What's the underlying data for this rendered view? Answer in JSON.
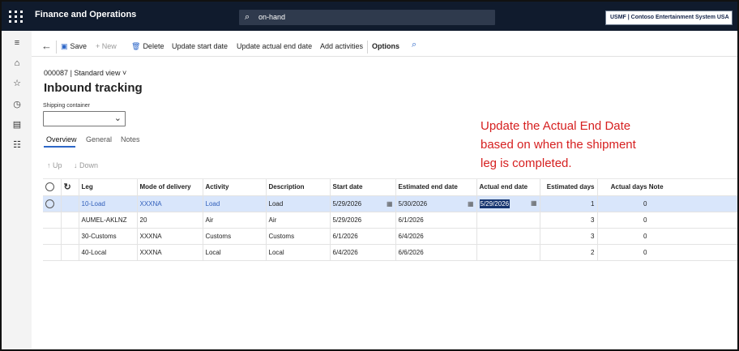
{
  "app": {
    "name": "Finance and Operations",
    "search_text": "on-hand",
    "company": "USMF | Contoso Entertainment System USA"
  },
  "toolbar": {
    "save": "Save",
    "new": "New",
    "delete": "Delete",
    "update_start_date": "Update start date",
    "update_actual_end_date": "Update actual end date",
    "add_activities": "Add activities",
    "options": "Options"
  },
  "record": {
    "id": "000087",
    "view": "Standard view",
    "title": "Inbound tracking",
    "shipping_container_label": "Shipping container",
    "shipping_container_value": ""
  },
  "tabs": [
    "Overview",
    "General",
    "Notes"
  ],
  "move": {
    "up": "Up",
    "down": "Down"
  },
  "table": {
    "headers": [
      "Leg",
      "Mode of delivery",
      "Activity",
      "Description",
      "Start date",
      "Estimated end date",
      "Actual end date",
      "Estimated days",
      "Actual days",
      "Note"
    ],
    "rows": [
      {
        "leg": "10-Load",
        "mode": "XXXNA",
        "activity": "Load",
        "description": "Load",
        "start": "5/29/2026",
        "estimated_end": "5/30/2026",
        "actual_end": "5/29/2026",
        "estimated_days": "1",
        "actual_days": "0",
        "note": ""
      },
      {
        "leg": "AUMEL-AKLNZ",
        "mode": "20",
        "activity": "Air",
        "description": "Air",
        "start": "5/29/2026",
        "estimated_end": "6/1/2026",
        "actual_end": "",
        "estimated_days": "3",
        "actual_days": "0",
        "note": ""
      },
      {
        "leg": "30-Customs",
        "mode": "XXXNA",
        "activity": "Customs",
        "description": "Customs",
        "start": "6/1/2026",
        "estimated_end": "6/4/2026",
        "actual_end": "",
        "estimated_days": "3",
        "actual_days": "0",
        "note": ""
      },
      {
        "leg": "40-Local",
        "mode": "XXXNA",
        "activity": "Local",
        "description": "Local",
        "start": "6/4/2026",
        "estimated_end": "6/6/2026",
        "actual_end": "",
        "estimated_days": "2",
        "actual_days": "0",
        "note": ""
      }
    ]
  },
  "annotation": {
    "line1": "Update the Actual End Date",
    "line2": "based on when the shipment",
    "line3": "leg is completed."
  },
  "colors": {
    "topbar": "#101b2d",
    "accent": "#2d67c8",
    "selected_row": "#d9e6fb",
    "annotation": "#d62020"
  },
  "icons": {
    "app_launcher": "waffle-icon",
    "search": "search-icon",
    "back": "back-arrow-icon",
    "save": "save-icon",
    "new": "plus-icon",
    "delete": "trash-icon",
    "calendar": "calendar-icon",
    "refresh": "refresh-icon"
  }
}
